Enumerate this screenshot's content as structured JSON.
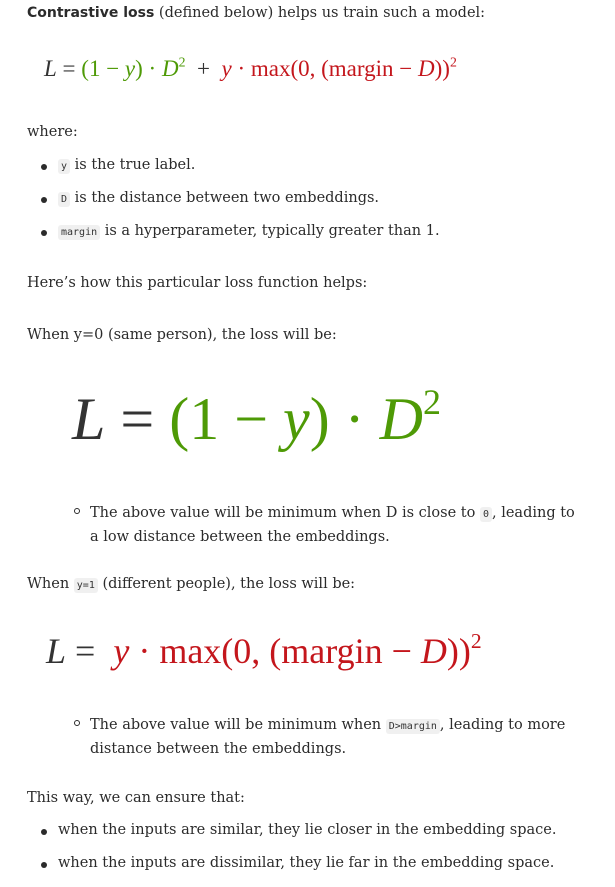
{
  "intro": {
    "bold": "Contrastive loss",
    "rest": " (defined below) helps us train such a model:"
  },
  "equation1": {
    "lhs": "L",
    "eq": "=",
    "t1_open": "(1 − ",
    "t1_y": "y",
    "t1_close": ") · ",
    "t1_D": "D",
    "t1_pow": "2",
    "plus": "+",
    "t2_y": "y",
    "t2_mid": " · max(0, (margin − ",
    "t2_D": "D",
    "t2_close": "))",
    "t2_pow": "2"
  },
  "where_label": "where:",
  "definitions": [
    {
      "code": "y",
      "text": "is the true label."
    },
    {
      "code": "D",
      "text": "is the distance between two embeddings."
    },
    {
      "code": "margin",
      "text": "is a hyperparameter, typically greater than 1."
    }
  ],
  "helps_text": "Here’s how this particular loss function helps:",
  "case_same": "When y=0 (same person), the loss will be:",
  "equation2": {
    "lhs": "L",
    "eq": "=",
    "open": "(1 − ",
    "y": "y",
    "close": ") · ",
    "D": "D",
    "pow": "2"
  },
  "note_same": {
    "line1_before": "The above value will be minimum when D is close to ",
    "code": "0",
    "line1_after": ", leading to",
    "line2": "a low distance between the embeddings."
  },
  "case_diff": {
    "before": "When ",
    "code": "y=1",
    "after": " (different people), the loss will be:"
  },
  "equation3": {
    "lhs": "L",
    "eq": "=",
    "y": "y",
    "mid": " · max(0, (margin − ",
    "D": "D",
    "close": "))",
    "pow": "2"
  },
  "note_diff": {
    "line1_before": "The above value will be minimum when ",
    "code": "D>margin",
    "line1_after": ", leading to more",
    "line2": "distance between the embeddings."
  },
  "ensure_text": "This way, we can ensure that:",
  "conclusions": [
    "when the inputs are similar, they lie closer in the embedding space.",
    "when the inputs are dissimilar, they lie far in the embedding space."
  ],
  "colors": {
    "text": "#2b2b2b",
    "green": "#4e9a06",
    "red": "#c4161c",
    "code_bg": "#f0f0f0"
  }
}
